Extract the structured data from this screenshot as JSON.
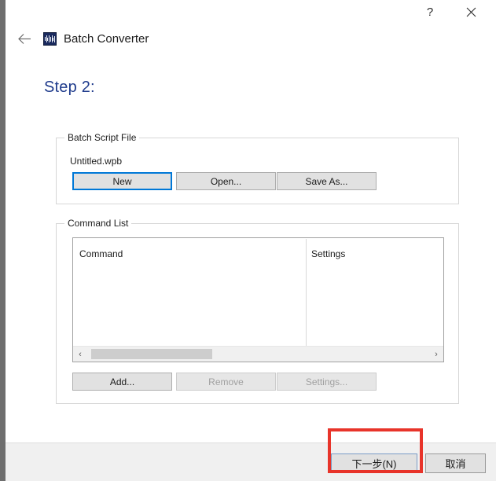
{
  "window": {
    "app_title": "Batch Converter",
    "app_icon": "waveform-icon",
    "back_icon": "back-arrow-icon",
    "help_label": "?",
    "close_icon": "close-icon"
  },
  "content": {
    "step_heading": "Step 2:"
  },
  "batch_script_file": {
    "group_title": "Batch Script File",
    "file_name": "Untitled.wpb",
    "buttons": [
      {
        "label": "New",
        "state": "focused"
      },
      {
        "label": "Open...",
        "state": "normal"
      },
      {
        "label": "Save As...",
        "state": "normal"
      }
    ]
  },
  "command_list": {
    "group_title": "Command List",
    "columns": [
      {
        "label": "Command"
      },
      {
        "label": "Settings"
      }
    ],
    "rows": [],
    "scrollbar": {
      "left_arrow": "‹",
      "right_arrow": "›"
    },
    "buttons": [
      {
        "label": "Add...",
        "state": "normal"
      },
      {
        "label": "Remove",
        "state": "disabled"
      },
      {
        "label": "Settings...",
        "state": "disabled"
      }
    ]
  },
  "footer": {
    "next_label": "下一步(N)",
    "cancel_label": "取消"
  },
  "colors": {
    "accent_blue": "#0078d7",
    "heading_blue": "#1f3b8c",
    "highlight_red": "#e8342a",
    "button_face": "#e1e1e1",
    "footer_bg": "#f0f0f0"
  }
}
